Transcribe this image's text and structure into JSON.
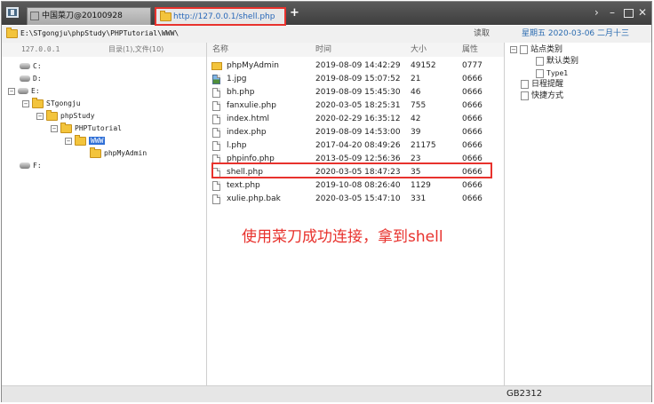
{
  "tabs": [
    {
      "label": "中国菜刀@20100928"
    },
    {
      "label": "http://127.0.0.1/shell.php"
    }
  ],
  "address": {
    "path": "E:\\STgongju\\phpStudy\\PHPTutorial\\WWW\\",
    "read_label": "读取",
    "date_label": "星期五 2020-03-06 二月十三"
  },
  "left": {
    "header_ip": "127.0.0.1",
    "header_count": "目录(1),文件(10)",
    "tree": [
      {
        "label": "C:",
        "level": 0,
        "kind": "drive"
      },
      {
        "label": "D:",
        "level": 0,
        "kind": "drive"
      },
      {
        "label": "E:",
        "level": 0,
        "kind": "drive"
      },
      {
        "label": "STgongju",
        "level": 1,
        "kind": "folder"
      },
      {
        "label": "phpStudy",
        "level": 2,
        "kind": "folder"
      },
      {
        "label": "PHPTutorial",
        "level": 3,
        "kind": "folder"
      },
      {
        "label": "WWW",
        "level": 4,
        "kind": "folder"
      },
      {
        "label": "phpMyAdmin",
        "level": 5,
        "kind": "folder"
      },
      {
        "label": "F:",
        "level": 0,
        "kind": "drive"
      }
    ]
  },
  "files": {
    "columns": {
      "name": "名称",
      "time": "时间",
      "size": "大小",
      "attr": "属性"
    },
    "rows": [
      {
        "name": "phpMyAdmin",
        "time": "2019-08-09 14:42:29",
        "size": "49152",
        "attr": "0777",
        "type": "folder"
      },
      {
        "name": "1.jpg",
        "time": "2019-08-09 15:07:52",
        "size": "21",
        "attr": "0666",
        "type": "image"
      },
      {
        "name": "bh.php",
        "time": "2019-08-09 15:45:30",
        "size": "46",
        "attr": "0666",
        "type": "file"
      },
      {
        "name": "fanxulie.php",
        "time": "2020-03-05 18:25:31",
        "size": "755",
        "attr": "0666",
        "type": "file"
      },
      {
        "name": "index.html",
        "time": "2020-02-29 16:35:12",
        "size": "42",
        "attr": "0666",
        "type": "file"
      },
      {
        "name": "index.php",
        "time": "2019-08-09 14:53:00",
        "size": "39",
        "attr": "0666",
        "type": "file"
      },
      {
        "name": "l.php",
        "time": "2017-04-20 08:49:26",
        "size": "21175",
        "attr": "0666",
        "type": "file"
      },
      {
        "name": "phpinfo.php",
        "time": "2013-05-09 12:56:36",
        "size": "23",
        "attr": "0666",
        "type": "file"
      },
      {
        "name": "shell.php",
        "time": "2020-03-05 18:47:23",
        "size": "35",
        "attr": "0666",
        "type": "file"
      },
      {
        "name": "text.php",
        "time": "2019-10-08 08:26:40",
        "size": "1129",
        "attr": "0666",
        "type": "file"
      },
      {
        "name": "xulie.php.bak",
        "time": "2020-03-05 15:47:10",
        "size": "331",
        "attr": "0666",
        "type": "file"
      }
    ]
  },
  "caption": "使用菜刀成功连接，拿到shell",
  "right": {
    "items": [
      {
        "label": "站点类别",
        "level": 0,
        "toggle": "⊟"
      },
      {
        "label": "默认类别",
        "level": 1
      },
      {
        "label": "Type1",
        "level": 1
      },
      {
        "label": "日程提醒",
        "level": 0
      },
      {
        "label": "快捷方式",
        "level": 0
      }
    ]
  },
  "status": {
    "encoding": "GB2312"
  },
  "colors": {
    "highlight": "#e8322d",
    "accent": "#2767b8"
  }
}
